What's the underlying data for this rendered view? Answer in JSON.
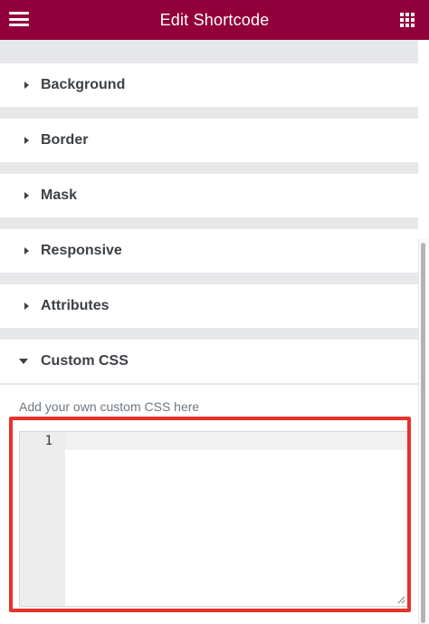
{
  "header": {
    "title": "Edit Shortcode",
    "menu_icon": "hamburger-menu-icon",
    "apps_icon": "grid-apps-icon"
  },
  "sections": [
    {
      "label": "Background",
      "expanded": false
    },
    {
      "label": "Border",
      "expanded": false
    },
    {
      "label": "Mask",
      "expanded": false
    },
    {
      "label": "Responsive",
      "expanded": false
    },
    {
      "label": "Attributes",
      "expanded": false
    },
    {
      "label": "Custom CSS",
      "expanded": true
    }
  ],
  "custom_css": {
    "help_text": "Add your own custom CSS here",
    "line_number": "1",
    "value": ""
  },
  "colors": {
    "header": "#92003b",
    "highlight": "#e8322b",
    "text": "#3c4147"
  }
}
